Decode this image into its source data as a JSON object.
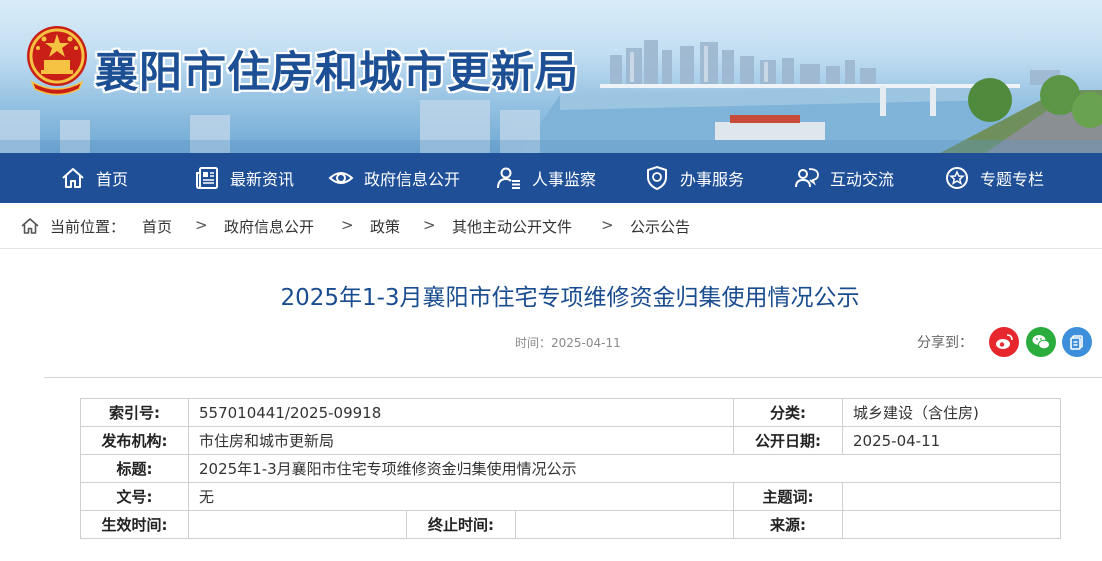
{
  "header": {
    "site_title": "襄阳市住房和城市更新局",
    "emblem_icon": "national-emblem-icon",
    "accent": "#1c4f93"
  },
  "nav": {
    "background": "#1f4f97",
    "items": [
      {
        "label": "首页",
        "icon": "home-icon"
      },
      {
        "label": "最新资讯",
        "icon": "newspaper-icon"
      },
      {
        "label": "政府信息公开",
        "icon": "eye-icon"
      },
      {
        "label": "人事监察",
        "icon": "person-list-icon"
      },
      {
        "label": "办事服务",
        "icon": "shield-icon"
      },
      {
        "label": "互动交流",
        "icon": "people-chat-icon"
      },
      {
        "label": "专题专栏",
        "icon": "star-badge-icon"
      }
    ]
  },
  "breadcrumb": {
    "label": "当前位置：",
    "separator": ">",
    "items": [
      "首页",
      "政府信息公开",
      "政策",
      "其他主动公开文件",
      "公示公告"
    ]
  },
  "article": {
    "title": "2025年1-3月襄阳市住宅专项维修资金归集使用情况公示",
    "time": "时间：2025-04-11",
    "share_label": "分享到：",
    "share_buttons": [
      {
        "icon": "weibo-icon",
        "color": "#e6272d"
      },
      {
        "icon": "wechat-icon",
        "color": "#2bad3e"
      },
      {
        "icon": "qzone-icon",
        "color": "#3d8fdb"
      }
    ]
  },
  "info": {
    "index_label": "索引号:",
    "index_value": "557010441/2025-09918",
    "category_label": "分类:",
    "category_value": "城乡建设（含住房)",
    "publisher_label": "发布机构:",
    "publisher_value": "市住房和城市更新局",
    "pubdate_label": "公开日期:",
    "pubdate_value": "2025-04-11",
    "title_label": "标题:",
    "title_value": "2025年1-3月襄阳市住宅专项维修资金归集使用情况公示",
    "docno_label": "文号:",
    "docno_value": "无",
    "keyword_label": "主题词:",
    "keyword_value": "",
    "effective_label": "生效时间:",
    "effective_value": "",
    "expire_label": "终止时间:",
    "expire_value": "",
    "source_label": "来源:",
    "source_value": ""
  }
}
